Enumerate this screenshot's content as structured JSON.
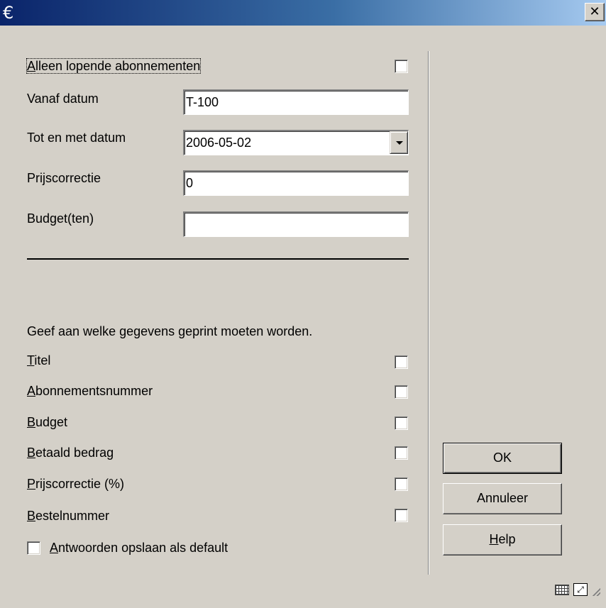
{
  "window": {
    "title_glyph": "€",
    "close_glyph": "✕"
  },
  "form": {
    "running_only": {
      "label": "Alleen lopende abonnementen",
      "checked": false
    },
    "from_date": {
      "label": "Vanaf datum",
      "value": "T-100"
    },
    "to_date": {
      "label": "Tot en met datum",
      "value": "2006-05-02"
    },
    "price_correction": {
      "label": "Prijscorrectie",
      "value": "0"
    },
    "budgets": {
      "label": "Budget(ten)",
      "value": ""
    }
  },
  "print": {
    "heading": "Geef aan welke gegevens geprint moeten worden.",
    "options": [
      {
        "label": "Titel",
        "checked": false
      },
      {
        "label": "Abonnementsnummer",
        "checked": false
      },
      {
        "label": "Budget",
        "checked": false
      },
      {
        "label": "Betaald bedrag",
        "checked": false
      },
      {
        "label": "Prijscorrectie (%)",
        "checked": false
      },
      {
        "label": "Bestelnummer",
        "checked": false
      }
    ]
  },
  "save_default": {
    "label": "Antwoorden opslaan als default",
    "checked": false
  },
  "buttons": {
    "ok": "OK",
    "cancel": "Annuleer",
    "help": "Help"
  },
  "status_icons": [
    "keyboard-icon",
    "maximize-icon",
    "resize-grip-icon"
  ],
  "colors": {
    "titlebar_start": "#0a246a",
    "titlebar_end": "#a6caf0",
    "dialog_bg": "#d4d0c8"
  }
}
